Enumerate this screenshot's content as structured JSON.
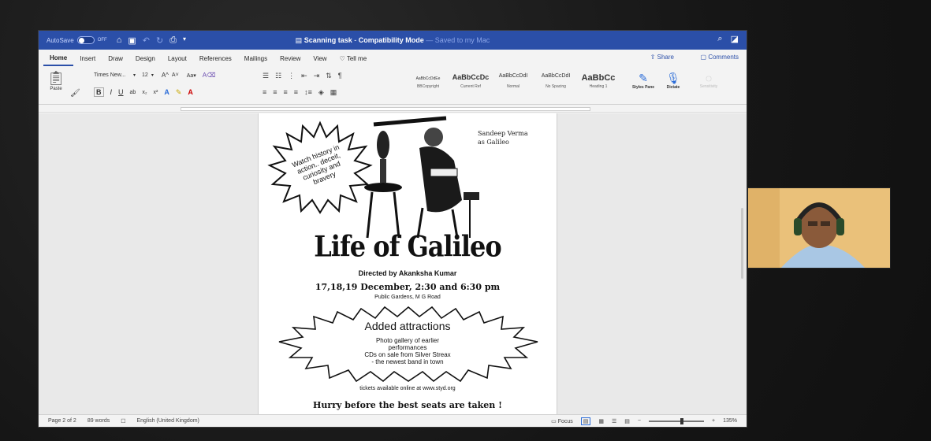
{
  "titlebar": {
    "autosave_label": "AutoSave",
    "autosave_state": "OFF",
    "doc_title": "Scanning task",
    "mode": "Compatibility Mode",
    "saved_status": "Saved to my Mac"
  },
  "tabs": [
    "Home",
    "Insert",
    "Draw",
    "Design",
    "Layout",
    "References",
    "Mailings",
    "Review",
    "View",
    "Tell me"
  ],
  "share_label": "Share",
  "comments_label": "Comments",
  "ribbon": {
    "paste_label": "Paste",
    "font_name": "Times New...",
    "font_size": "12",
    "styles": [
      {
        "preview": "AaBbCcDdEe",
        "name": "BBCopyright"
      },
      {
        "preview": "AaBbCcDc",
        "name": "Current Ref"
      },
      {
        "preview": "AaBbCcDdI",
        "name": "Normal"
      },
      {
        "preview": "AaBbCcDdI",
        "name": "No Spacing"
      },
      {
        "preview": "AaBbCc",
        "name": "Heading 1"
      }
    ],
    "styles_pane_label": "Styles Pane",
    "dictate_label": "Dictate",
    "sensitivity_label": "Sensitivity"
  },
  "poster": {
    "starburst_text": [
      "Watch history in",
      "action.. deceit,",
      "curiosity and",
      "bravery"
    ],
    "actor_credit": [
      "Sandeep Verma",
      "as Galileo"
    ],
    "title": "Life of Galileo",
    "director": "Directed by Akanksha Kumar",
    "dates": "17,18,19 December, 2:30 and 6:30 pm",
    "venue": "Public Gardens, M G Road",
    "attractions_heading": "Added attractions",
    "attractions": [
      "Photo gallery of earlier",
      "performances",
      "CDs on sale from Silver Streax",
      "- the newest band in town"
    ],
    "tickets": "tickets available online at www.styd.org",
    "hurry": "Hurry before the best seats are taken !"
  },
  "statusbar": {
    "page": "Page 2 of 2",
    "words": "89 words",
    "language": "English (United Kingdom)",
    "focus": "Focus",
    "zoom": "135%"
  },
  "colors": {
    "titlebar": "#2b4fa8",
    "backdrop": "#1a1a1a"
  }
}
